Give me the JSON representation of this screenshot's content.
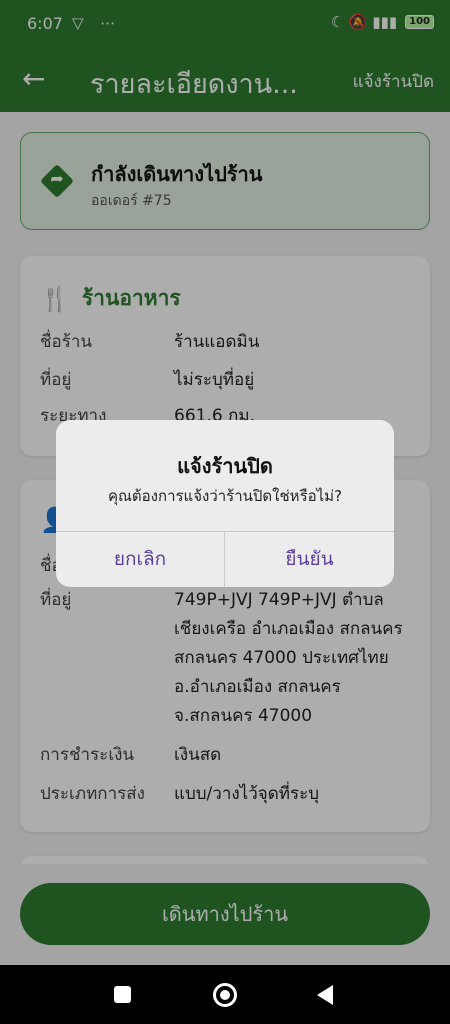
{
  "status_bar": {
    "time": "6:07",
    "left_icons": "▽ ⋯",
    "right_icons": "☾ 🔕 ▮▮▮",
    "battery": "100"
  },
  "app_bar": {
    "title": "รายละเอียดงาน...",
    "action_label": "แจ้งร้านปิด"
  },
  "status_card": {
    "title": "กำลังเดินทางไปร้าน",
    "subtitle": "ออเดอร์ #75"
  },
  "restaurant_card": {
    "title": "ร้านอาหาร",
    "rows": [
      {
        "label": "ชื่อร้าน",
        "value": "ร้านแอดมิน"
      },
      {
        "label": "ที่อยู่",
        "value": "ไม่ระบุที่อยู่"
      },
      {
        "label": "ระยะทาง",
        "value": "661.6 กม."
      }
    ]
  },
  "customer_card": {
    "rows": [
      {
        "label": "ชื่อ",
        "value": ""
      },
      {
        "label": "ที่อยู่",
        "value": "749P+JVJ 749P+JVJ ตำบล เชียงเครือ อำเภอเมือง สกลนคร สกลนคร 47000 ประเทศไทย อ.อำเภอเมือง สกลนคร จ.สกลนคร 47000"
      },
      {
        "label": "การชำระเงิน",
        "value": "เงินสด"
      },
      {
        "label": "ประเภทการส่ง",
        "value": "แบบ/วางไว้จุดที่ระบุ"
      }
    ]
  },
  "main_button": {
    "label": "เดินทางไปร้าน"
  },
  "dialog": {
    "title": "แจ้งร้านปิด",
    "message": "คุณต้องการแจ้งว่าร้านปิดใช่หรือไม่?",
    "cancel_label": "ยกเลิก",
    "confirm_label": "ยืนยัน"
  },
  "colors": {
    "primary": "#2f7d32",
    "dialog_button": "#5d3fa0",
    "background": "#f2f2f2"
  }
}
